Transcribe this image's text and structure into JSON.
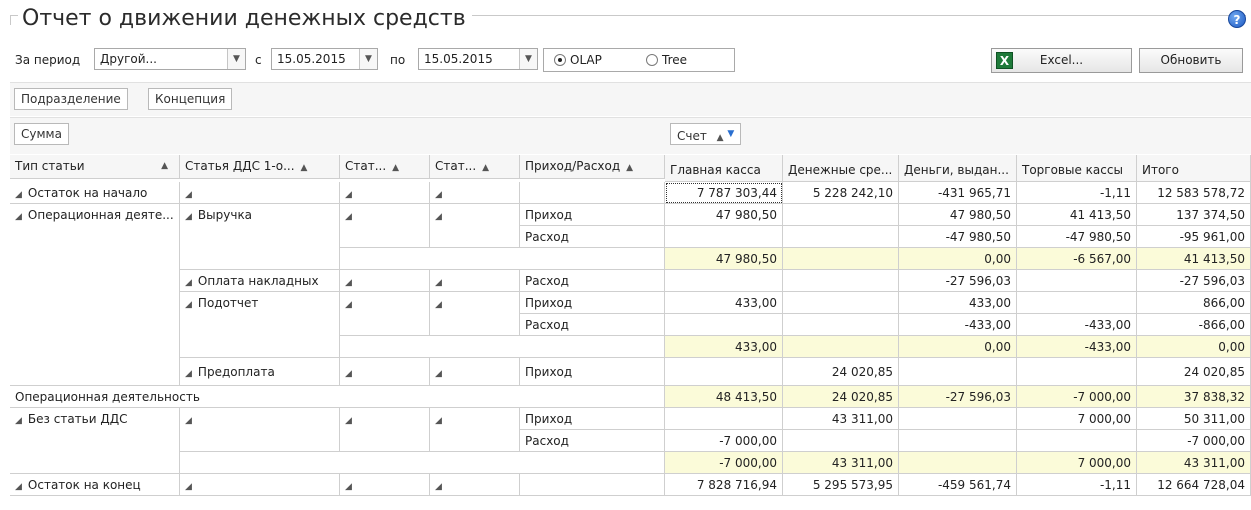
{
  "title": "Отчет о движении денежных средств",
  "toolbar": {
    "period_label": "За период",
    "period_value": "Другой...",
    "from_label": "с",
    "from_date": "15.05.2015",
    "to_label": "по",
    "to_date": "15.05.2015",
    "mode_options": [
      "OLAP",
      "Tree"
    ],
    "mode_selected": "OLAP",
    "excel_label": "Excel...",
    "refresh_label": "Обновить"
  },
  "filter_fields": [
    "Подразделение",
    "Концепция"
  ],
  "data_fields": [
    "Сумма"
  ],
  "column_field": {
    "label": "Счет",
    "sort": "asc",
    "filtered": true
  },
  "row_headers": [
    {
      "label": "Тип статьи",
      "sort": "asc"
    },
    {
      "label": "Статья ДДС 1-о...",
      "sort": "asc"
    },
    {
      "label": "Стат...",
      "sort": "asc"
    },
    {
      "label": "Стат...",
      "sort": "asc"
    },
    {
      "label": "Приход/Расход",
      "sort": "asc"
    }
  ],
  "value_headers": [
    "Главная касса",
    "Денежные сре...",
    "Деньги, выдан...",
    "Торговые кассы",
    "Итого"
  ],
  "groups": {
    "opening": "Остаток на начало",
    "operational": "Операционная деяте...",
    "operational_total": "Операционная деятельность",
    "no_article": "Без статьи ДДС",
    "closing": "Остаток на конец"
  },
  "articles": {
    "revenue": "Выручка",
    "invoice_payment": "Оплата накладных",
    "accountable": "Подотчет",
    "prepayment": "Предоплата"
  },
  "directions": {
    "income": "Приход",
    "expense": "Расход"
  },
  "rows": {
    "opening": [
      "7 787 303,44",
      "5 228 242,10",
      "-431 965,71",
      "-1,11",
      "12 583 578,72"
    ],
    "revenue_income": [
      "47 980,50",
      "",
      "47 980,50",
      "41 413,50",
      "137 374,50"
    ],
    "revenue_expense": [
      "",
      "",
      "-47 980,50",
      "-47 980,50",
      "-95 961,00"
    ],
    "revenue_total": [
      "47 980,50",
      "",
      "0,00",
      "-6 567,00",
      "41 413,50"
    ],
    "invoice_expense": [
      "",
      "",
      "-27 596,03",
      "",
      "-27 596,03"
    ],
    "accountable_income": [
      "433,00",
      "",
      "433,00",
      "",
      "866,00"
    ],
    "accountable_expense": [
      "",
      "",
      "-433,00",
      "-433,00",
      "-866,00"
    ],
    "accountable_total": [
      "433,00",
      "",
      "0,00",
      "-433,00",
      "0,00"
    ],
    "prepayment_income": [
      "",
      "24 020,85",
      "",
      "",
      "24 020,85"
    ],
    "operational_total": [
      "48 413,50",
      "24 020,85",
      "-27 596,03",
      "-7 000,00",
      "37 838,32"
    ],
    "noarticle_income": [
      "",
      "43 311,00",
      "",
      "7 000,00",
      "50 311,00"
    ],
    "noarticle_expense": [
      "-7 000,00",
      "",
      "",
      "",
      "-7 000,00"
    ],
    "noarticle_total": [
      "-7 000,00",
      "43 311,00",
      "",
      "7 000,00",
      "43 311,00"
    ],
    "closing": [
      "7 828 716,94",
      "5 295 573,95",
      "-459 561,74",
      "-1,11",
      "12 664 728,04"
    ]
  }
}
